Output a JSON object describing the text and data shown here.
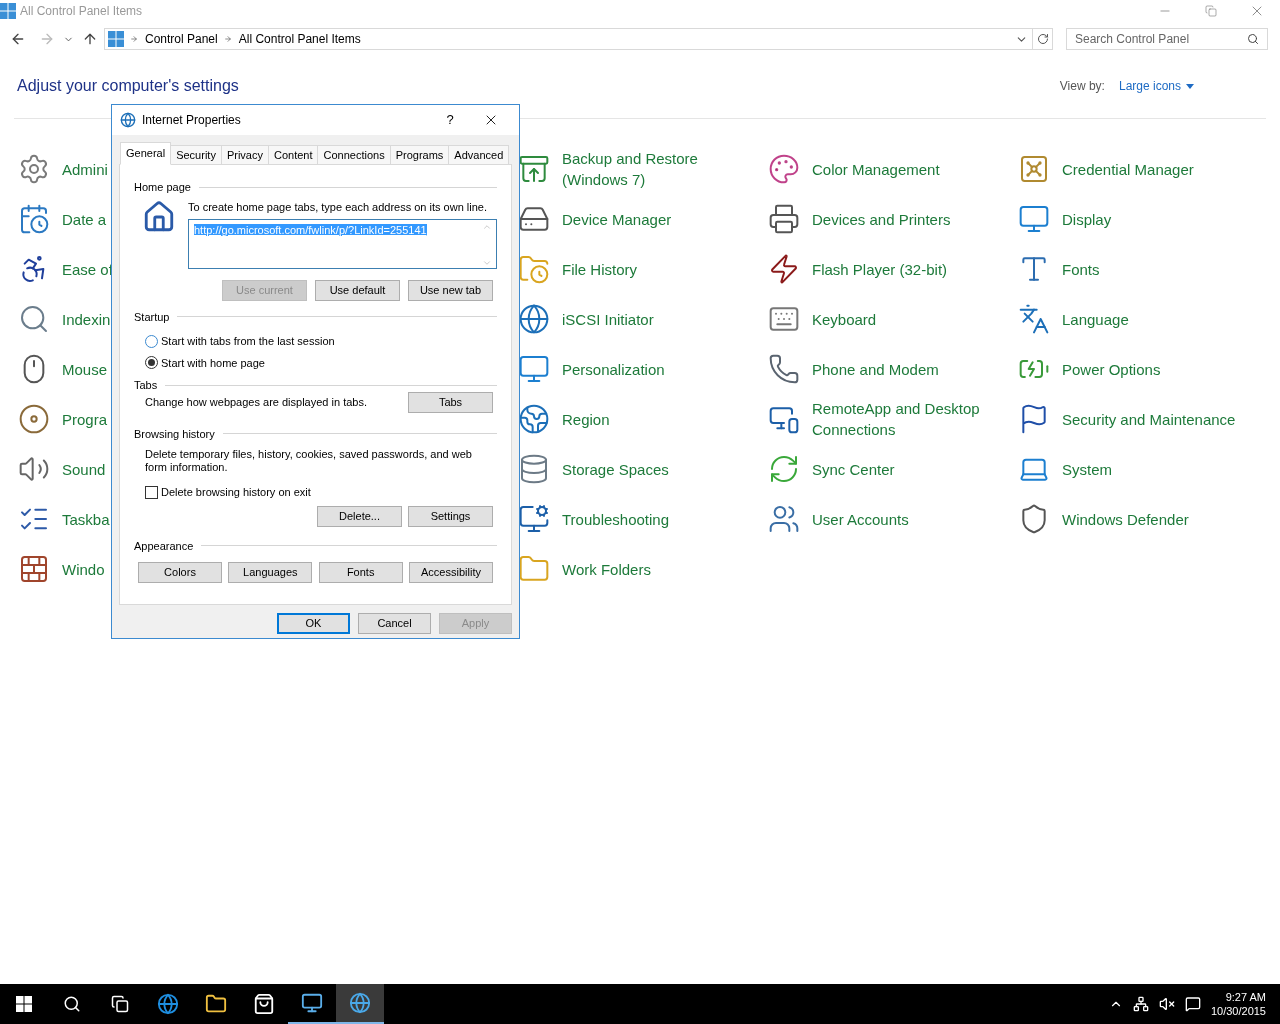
{
  "window": {
    "title": "All Control Panel Items"
  },
  "address_bar": {
    "breadcrumbs": [
      "Control Panel",
      "All Control Panel Items"
    ]
  },
  "search": {
    "placeholder": "Search Control Panel"
  },
  "header": {
    "title": "Adjust your computer's settings",
    "view_by_label": "View by:",
    "view_by_value": "Large icons"
  },
  "columns": [
    {
      "items": [
        {
          "label": "Admini"
        },
        {
          "label": "Date a"
        },
        {
          "label": "Ease of"
        },
        {
          "label": "Indexin"
        },
        {
          "label": "Mouse"
        },
        {
          "label": "Progra"
        },
        {
          "label": "Sound"
        },
        {
          "label": "Taskba"
        },
        {
          "label": "Windo"
        }
      ]
    },
    {
      "items": [
        {
          "label": "Backup and Restore (Windows 7)"
        },
        {
          "label": "Device Manager"
        },
        {
          "label": "File History"
        },
        {
          "label": "iSCSI Initiator"
        },
        {
          "label": "Personalization"
        },
        {
          "label": "Region"
        },
        {
          "label": "Storage Spaces"
        },
        {
          "label": "Troubleshooting"
        },
        {
          "label": "Work Folders"
        }
      ]
    },
    {
      "items": [
        {
          "label": "Color Management"
        },
        {
          "label": "Devices and Printers"
        },
        {
          "label": "Flash Player (32-bit)"
        },
        {
          "label": "Keyboard"
        },
        {
          "label": "Phone and Modem"
        },
        {
          "label": "RemoteApp and Desktop Connections"
        },
        {
          "label": "Sync Center"
        },
        {
          "label": "User Accounts"
        }
      ]
    },
    {
      "items": [
        {
          "label": "Credential Manager"
        },
        {
          "label": "Display"
        },
        {
          "label": "Fonts"
        },
        {
          "label": "Language"
        },
        {
          "label": "Power Options"
        },
        {
          "label": "Security and Maintenance"
        },
        {
          "label": "System"
        },
        {
          "label": "Windows Defender"
        }
      ]
    }
  ],
  "dialog": {
    "title": "Internet Properties",
    "help": "?",
    "tabs": [
      {
        "label": "General",
        "selected": true
      },
      {
        "label": "Security",
        "selected": false
      },
      {
        "label": "Privacy",
        "selected": false
      },
      {
        "label": "Content",
        "selected": false
      },
      {
        "label": "Connections",
        "selected": false
      },
      {
        "label": "Programs",
        "selected": false
      },
      {
        "label": "Advanced",
        "selected": false
      }
    ],
    "home_page": {
      "heading": "Home page",
      "hint": "To create home page tabs, type each address on its own line.",
      "value": "http://go.microsoft.com/fwlink/p/?LinkId=255141",
      "text_selected": true,
      "buttons": [
        {
          "label": "Use current",
          "disabled": true
        },
        {
          "label": "Use default",
          "disabled": false
        },
        {
          "label": "Use new tab",
          "disabled": false
        }
      ]
    },
    "startup": {
      "heading": "Startup",
      "options": [
        {
          "label": "Start with tabs from the last session",
          "selected": false
        },
        {
          "label": "Start with home page",
          "selected": true
        }
      ]
    },
    "tabs_section": {
      "heading": "Tabs",
      "text": "Change how webpages are displayed in tabs.",
      "button": "Tabs"
    },
    "browsing_history": {
      "heading": "Browsing history",
      "text": "Delete temporary files, history, cookies, saved passwords, and web form information.",
      "checkbox": {
        "label": "Delete browsing history on exit",
        "checked": false
      },
      "buttons": [
        "Delete...",
        "Settings"
      ]
    },
    "appearance": {
      "heading": "Appearance",
      "buttons": [
        "Colors",
        "Languages",
        "Fonts",
        "Accessibility"
      ]
    },
    "footer_buttons": [
      {
        "label": "OK",
        "default": true,
        "disabled": false
      },
      {
        "label": "Cancel",
        "default": false,
        "disabled": false
      },
      {
        "label": "Apply",
        "default": false,
        "disabled": true
      }
    ]
  },
  "taskbar": {
    "apps": [
      {
        "running": false,
        "selected": false
      },
      {
        "running": false,
        "selected": false
      },
      {
        "running": false,
        "selected": false
      },
      {
        "running": true,
        "selected": false
      },
      {
        "running": true,
        "selected": true
      }
    ],
    "clock": {
      "time": "9:27 AM",
      "date": "10/30/2015"
    }
  }
}
